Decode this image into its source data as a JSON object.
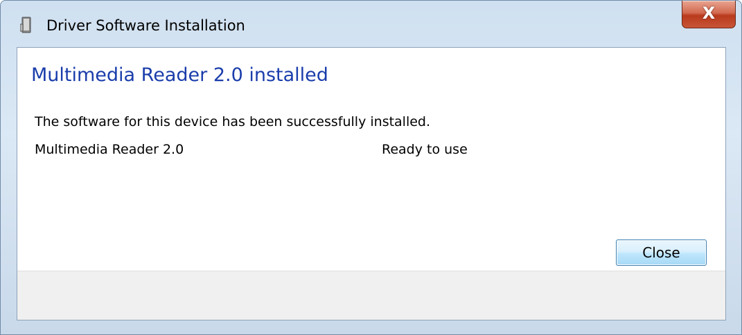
{
  "window": {
    "title": "Driver Software Installation",
    "title_icon": "device-installer-icon",
    "close_glyph": "X",
    "close_icon": "close-icon"
  },
  "content": {
    "heading": "Multimedia Reader 2.0 installed",
    "message": "The software for this device has been successfully installed.",
    "devices": [
      {
        "name": "Multimedia Reader 2.0",
        "status": "Ready to use"
      }
    ]
  },
  "footer": {
    "close_label": "Close"
  },
  "colors": {
    "heading": "#1a3dab",
    "footer_bg": "#f0f0f0",
    "close_button_border": "#3c7fb1",
    "titlebar_close": "#c85537"
  }
}
